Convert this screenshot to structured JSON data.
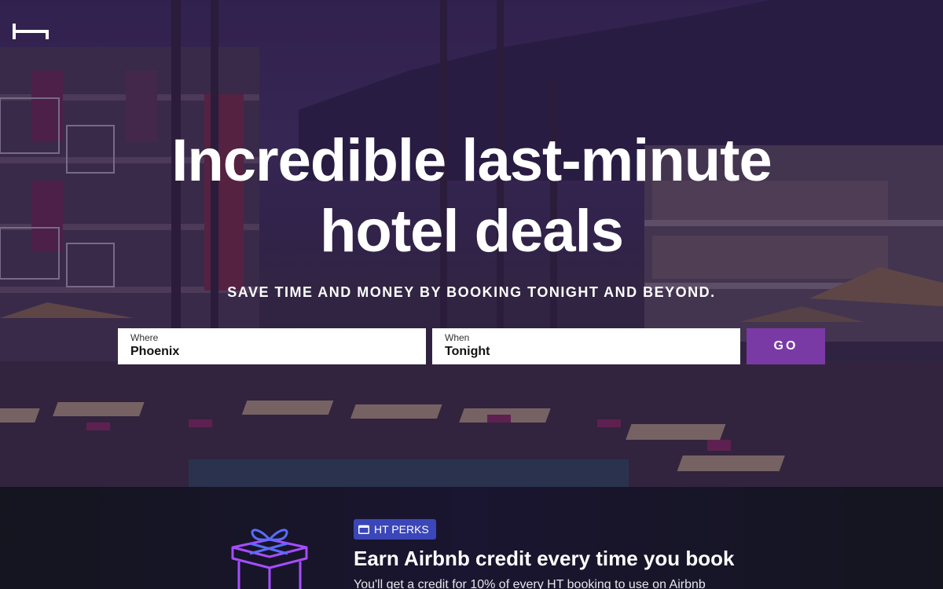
{
  "hero": {
    "headline_line1": "Incredible last-minute",
    "headline_line2": "hotel deals",
    "subhead": "SAVE TIME AND MONEY BY BOOKING TONIGHT AND BEYOND."
  },
  "search": {
    "where_label": "Where",
    "where_value": "Phoenix",
    "when_label": "When",
    "when_value": "Tonight",
    "go_label": "GO"
  },
  "perks": {
    "badge": "HT PERKS",
    "title": "Earn Airbnb credit every time you book",
    "body": "You'll get a credit for 10% of every HT booking to use on Airbnb"
  },
  "icons": {
    "logo": "hoteltonight-logo-icon",
    "badge_icon": "calendar-icon",
    "gift": "gift-icon"
  },
  "colors": {
    "go_button": "#7a3aa6",
    "badge": "#3b46b8",
    "gift_neon": "#a54dff"
  }
}
